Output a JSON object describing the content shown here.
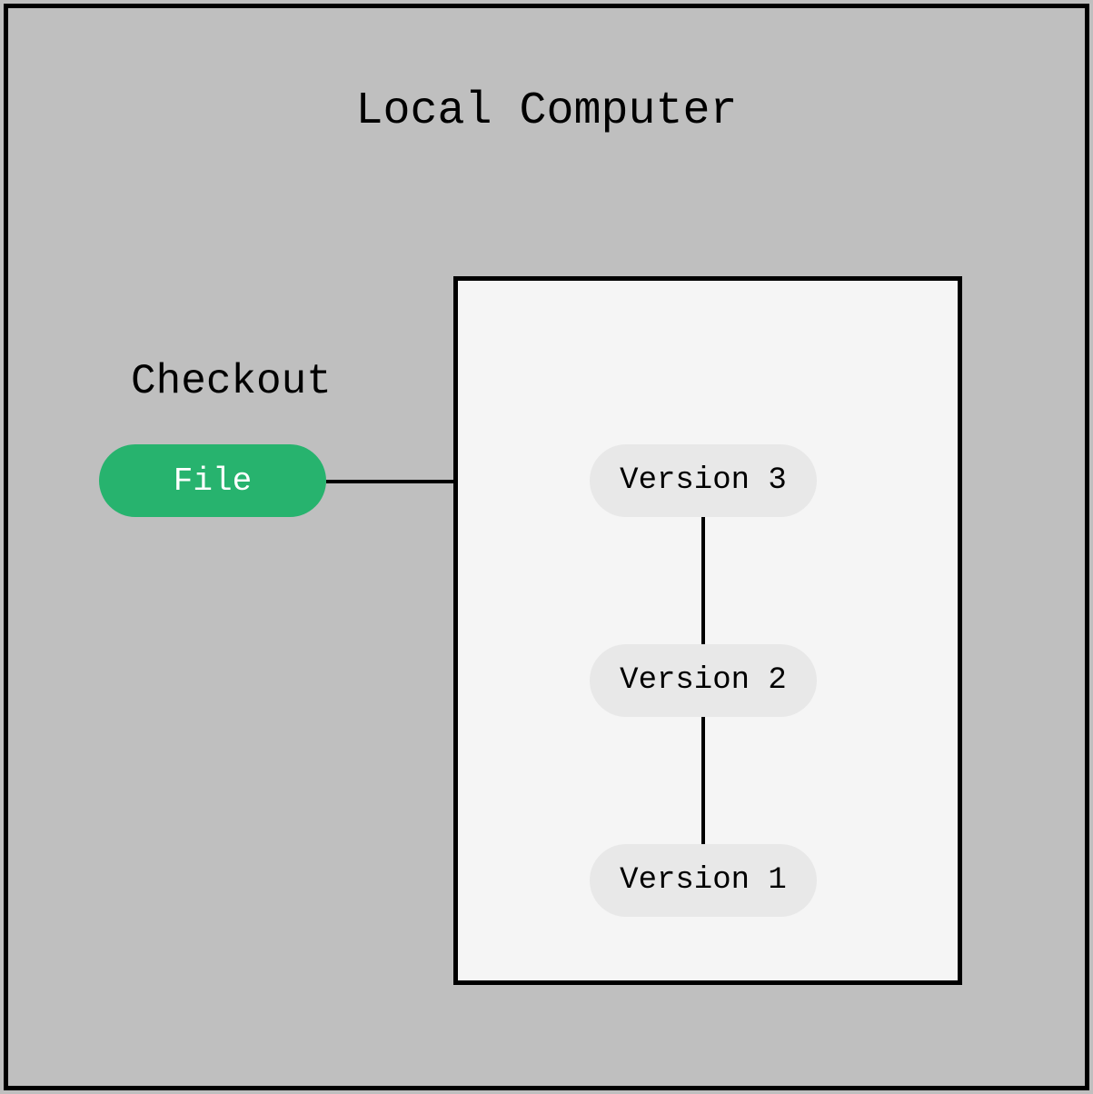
{
  "title": "Local Computer",
  "checkout": {
    "label": "Checkout",
    "file_label": "File"
  },
  "repository": {
    "versions": [
      {
        "label": "Version 3"
      },
      {
        "label": "Version 2"
      },
      {
        "label": "Version 1"
      }
    ]
  }
}
